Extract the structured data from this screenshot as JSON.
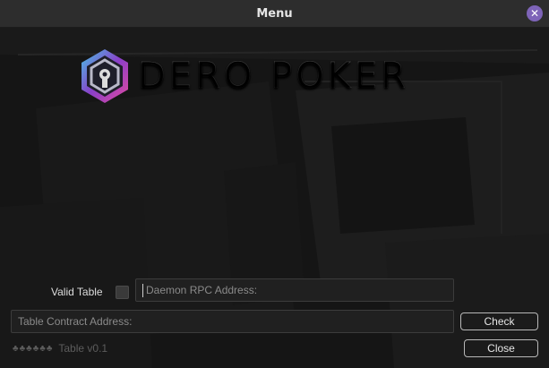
{
  "window": {
    "title": "Menu",
    "close_glyph": "✕"
  },
  "logo": {
    "text": "DERO POKER",
    "icon": "dero-hexagon-logo-icon"
  },
  "form": {
    "valid_table_label": "Valid Table",
    "daemon_placeholder": "Daemon RPC Address:",
    "contract_placeholder": "Table Contract Address:",
    "check_label": "Check",
    "close_label": "Close"
  },
  "footer": {
    "suits": "♣♣♣♣♣♣",
    "version": "Table v0.1"
  },
  "colors": {
    "accent": "#7e64b8",
    "logo_cyan": "#46c3e6",
    "logo_purple": "#8a3fc8",
    "logo_pink": "#e24aa0"
  }
}
